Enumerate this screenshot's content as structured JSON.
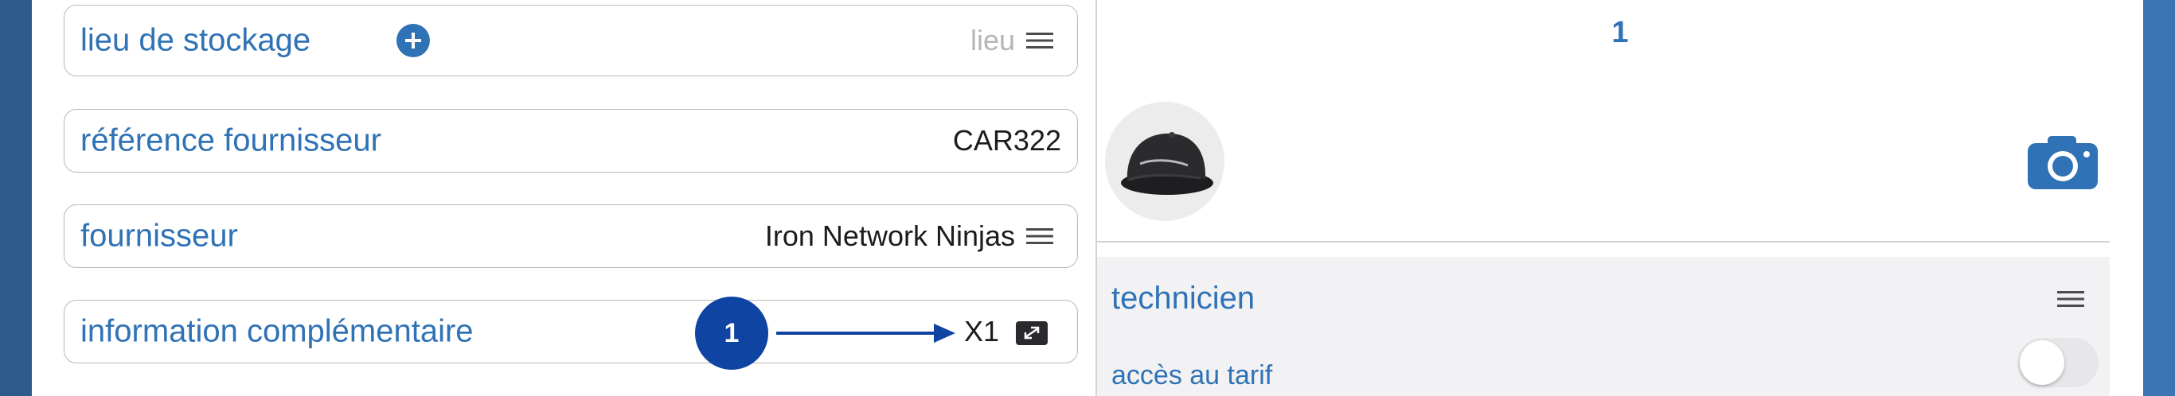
{
  "fields": {
    "storage": {
      "label": "lieu de stockage",
      "placeholder": "lieu"
    },
    "supplier_ref": {
      "label": "référence fournisseur",
      "value": "CAR322"
    },
    "supplier": {
      "label": "fournisseur",
      "value": "Iron Network Ninjas"
    },
    "extra_info": {
      "label": "information complémentaire",
      "value": "X1"
    }
  },
  "annotation": {
    "badge_number": "1"
  },
  "right": {
    "counter": "1",
    "photo_icon": "camera-icon",
    "technician": {
      "title": "technicien",
      "tariff_access_label": "accès au tarif",
      "tariff_access_enabled": false
    }
  },
  "colors": {
    "accent": "#2f72b5",
    "annotation": "#0f44a3",
    "edge_left": "#2e5b8c",
    "edge_right": "#3d74b4"
  }
}
